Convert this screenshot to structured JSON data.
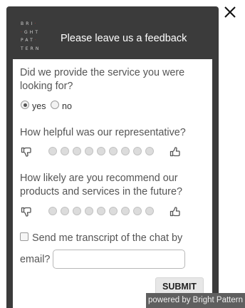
{
  "window": {
    "close_icon": "close-icon",
    "logo_rows": [
      "BRI·",
      "·GHT",
      "PAT·",
      "TERN"
    ],
    "title": "Please leave us a feedback"
  },
  "form": {
    "q1": {
      "text": "Did we provide the service you were looking for?",
      "options": [
        "yes",
        "no"
      ],
      "selected": "yes"
    },
    "q2": {
      "text": "How helpful was our representative?",
      "scale_points": 9,
      "low_icon": "thumbs-down-icon",
      "high_icon": "thumbs-up-icon"
    },
    "q3": {
      "text": "How likely are you recommend our products and services in the future?",
      "scale_points": 9,
      "low_icon": "thumbs-down-icon",
      "high_icon": "thumbs-up-icon"
    },
    "transcript": {
      "checkbox_label": "Send me transcript of the chat by",
      "email_label": "email?",
      "email_value": "",
      "checked": false
    },
    "submit_label": "SUBMIT"
  },
  "footer": {
    "powered_by": "powered by Bright Pattern"
  },
  "colors": {
    "panel_bg": "#3b3b3b",
    "accent_red": "#c0392b",
    "question_text": "#555555"
  }
}
